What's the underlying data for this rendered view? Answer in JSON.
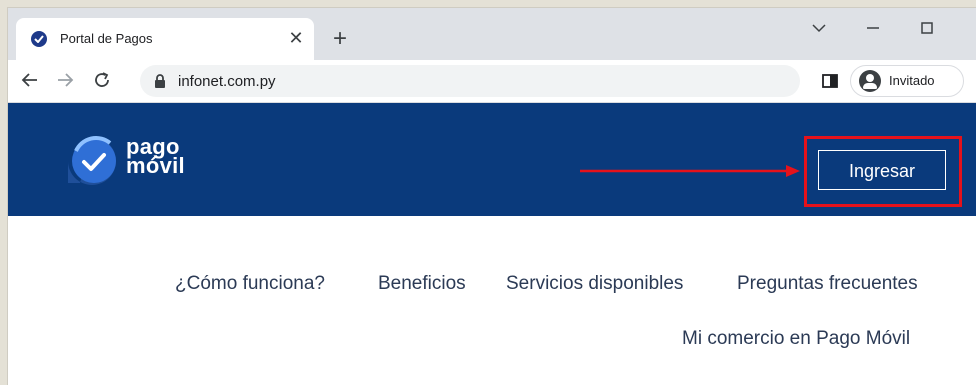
{
  "browser": {
    "tab_title": "Portal de Pagos",
    "tab_close": "✕",
    "new_tab": "+",
    "window_controls": {
      "minimize": "—",
      "maximize": "☐",
      "dropdown": "⌄"
    },
    "url": "infonet.com.py",
    "profile_label": "Invitado",
    "icons": [
      "back-icon",
      "forward-icon",
      "reload-icon",
      "lock-icon",
      "side-panel-icon",
      "profile-icon"
    ]
  },
  "site": {
    "logo_line1": "pago",
    "logo_line2": "móvil",
    "login_button": "Ingresar",
    "nav": [
      "¿Cómo funciona?",
      "Beneficios",
      "Servicios disponibles",
      "Preguntas frecuentes",
      "Mi comercio en Pago Móvil"
    ],
    "colors": {
      "header_bg": "#0a3a7c",
      "highlight": "#e6121b",
      "nav_text": "#2b3a55"
    }
  }
}
